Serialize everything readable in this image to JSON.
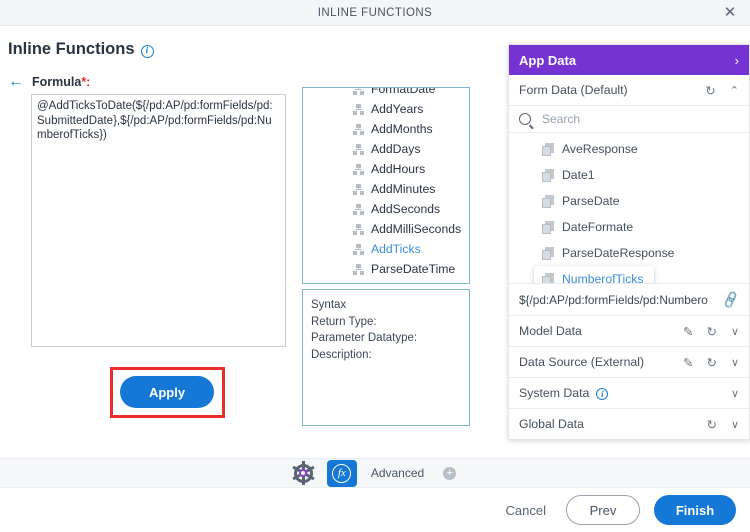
{
  "window": {
    "title": "INLINE FUNCTIONS",
    "close_label": "✕"
  },
  "left": {
    "page_title": "Inline Functions",
    "info_icon": "info-icon",
    "back_arrow": "←",
    "formula_label": "Formula",
    "required_marker": "*:",
    "formula_value": "@AddTicksToDate(${/pd:AP/pd:formFields/pd:SubmittedDate},${/pd:AP/pd:formFields/pd:NumberofTicks})",
    "apply_label": "Apply",
    "annotation_color": "#e8302a"
  },
  "functions": {
    "items": [
      {
        "label": "FormatDate",
        "selected": false
      },
      {
        "label": "AddYears",
        "selected": false
      },
      {
        "label": "AddMonths",
        "selected": false
      },
      {
        "label": "AddDays",
        "selected": false
      },
      {
        "label": "AddHours",
        "selected": false
      },
      {
        "label": "AddMinutes",
        "selected": false
      },
      {
        "label": "AddSeconds",
        "selected": false
      },
      {
        "label": "AddMilliSeconds",
        "selected": false
      },
      {
        "label": "AddTicks",
        "selected": true
      },
      {
        "label": "ParseDateTime",
        "selected": false
      }
    ]
  },
  "syntax": {
    "lines": [
      "Syntax",
      "Return Type:",
      "Parameter Datatype:",
      "Description:"
    ]
  },
  "app_data": {
    "header_title": "App Data",
    "header_chevron": "›",
    "form_data": {
      "label": "Form Data (Default)",
      "refresh_icon": "↻",
      "chevron": "⌃"
    },
    "search": {
      "placeholder": "Search",
      "value": ""
    },
    "items": [
      {
        "label": "AveResponse",
        "selected": false
      },
      {
        "label": "Date1",
        "selected": false
      },
      {
        "label": "ParseDate",
        "selected": false
      },
      {
        "label": "DateFormate",
        "selected": false
      },
      {
        "label": "ParseDateResponse",
        "selected": false
      },
      {
        "label": "NumberofTicks",
        "selected": true
      }
    ],
    "expression": {
      "value": "${/pd:AP/pd:formFields/pd:Numbero",
      "link_icon": "🔗"
    },
    "sections": [
      {
        "label": "Model Data",
        "edit": "✎",
        "refresh": "↻",
        "chevron": "∨",
        "info": false
      },
      {
        "label": "Data Source (External)",
        "edit": "✎",
        "refresh": "↻",
        "chevron": "∨",
        "info": false
      },
      {
        "label": "System Data",
        "edit": "",
        "refresh": "",
        "chevron": "∨",
        "info": true
      },
      {
        "label": "Global Data",
        "edit": "",
        "refresh": "↻",
        "chevron": "∨",
        "info": false
      }
    ]
  },
  "toolbar": {
    "gear_icon": "gear-icon",
    "fx_label": "fx",
    "advanced_label": "Advanced",
    "advanced_plus": "+"
  },
  "footer": {
    "cancel_label": "Cancel",
    "prev_label": "Prev",
    "finish_label": "Finish"
  },
  "colors": {
    "accent_blue": "#1578d6",
    "brand_purple": "#7633d4",
    "annotation_red": "#e8302a"
  }
}
